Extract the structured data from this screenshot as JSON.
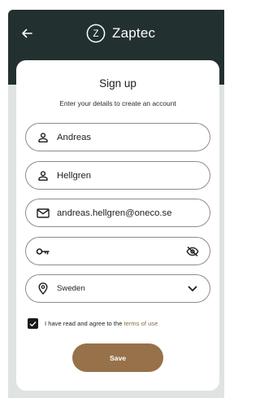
{
  "header": {
    "brand_name": "Zaptec",
    "logo_letter": "Z"
  },
  "signup": {
    "title": "Sign up",
    "subtitle": "Enter your details to create an account",
    "first_name": "Andreas",
    "last_name": "Hellgren",
    "email": "andreas.hellgren@oneco.se",
    "password": "",
    "country": "Sweden",
    "agree_prefix": "I have read and agree to the ",
    "terms_link": "terms of use",
    "agree_checked": true,
    "save_label": "Save"
  },
  "colors": {
    "header_bg": "#233030",
    "page_bg": "#dfe3e2",
    "accent": "#977149",
    "link": "#8a6a46"
  },
  "icons": [
    "back-arrow-icon",
    "zaptec-logo-icon",
    "person-icon",
    "email-icon",
    "key-icon",
    "eye-off-icon",
    "location-pin-icon",
    "chevron-down-icon",
    "checkmark-icon"
  ]
}
